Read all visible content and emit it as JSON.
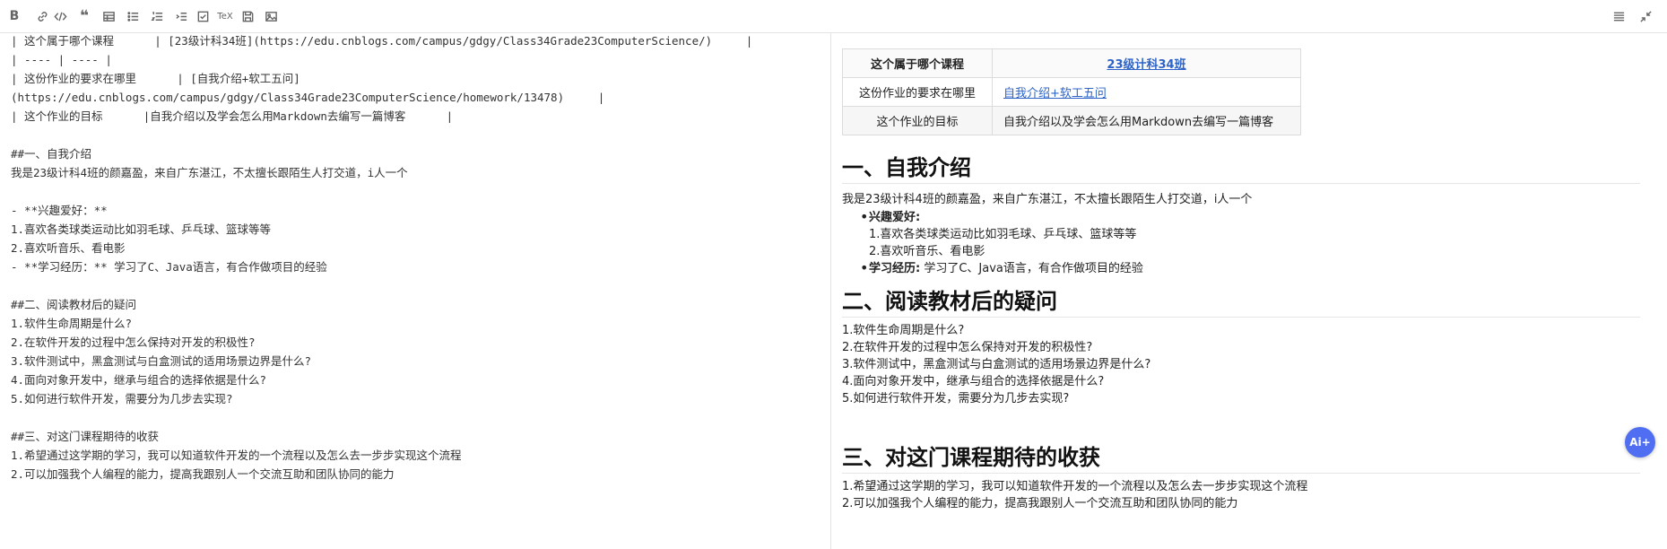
{
  "toolbar": {
    "bold": "B",
    "tex": "TeX"
  },
  "editor_lines": [
    "| 这个属于哪个课程      | [23级计科34班](https://edu.cnblogs.com/campus/gdgy/Class34Grade23ComputerScience/)     |",
    "| ---- | ---- |",
    "| 这份作业的要求在哪里      | [自我介绍+软工五问]",
    "(https://edu.cnblogs.com/campus/gdgy/Class34Grade23ComputerScience/homework/13478)     |",
    "| 这个作业的目标      |自我介绍以及学会怎么用Markdown去编写一篇博客      |",
    "",
    "##一、自我介绍",
    "我是23级计科4班的颜嘉盈，来自广东湛江，不太擅长跟陌生人打交道，i人一个",
    "",
    "- **兴趣爱好：**",
    "1.喜欢各类球类运动比如羽毛球、乒乓球、篮球等等",
    "2.喜欢听音乐、看电影",
    "- **学习经历：** 学习了C、Java语言，有合作做项目的经验",
    "",
    "##二、阅读教材后的疑问",
    "1.软件生命周期是什么?",
    "2.在软件开发的过程中怎么保持对开发的积极性?",
    "3.软件测试中，黑盒测试与白盒测试的适用场景边界是什么?",
    "4.面向对象开发中，继承与组合的选择依据是什么?",
    "5.如何进行软件开发，需要分为几步去实现?",
    "",
    "##三、对这门课程期待的收获",
    "1.希望通过这学期的学习，我可以知道软件开发的一个流程以及怎么去一步步实现这个流程",
    "2.可以加强我个人编程的能力，提高我跟别人一个交流互助和团队协同的能力"
  ],
  "preview": {
    "table": [
      {
        "k": "这个属于哪个课程",
        "v": "23级计科34班"
      },
      {
        "k": "这份作业的要求在哪里",
        "v": "自我介绍+软工五问"
      },
      {
        "k": "这个作业的目标",
        "v": "自我介绍以及学会怎么用Markdown去编写一篇博客"
      }
    ],
    "h1": "一、自我介绍",
    "intro": "我是23级计科4班的颜嘉盈，来自广东湛江，不太擅长跟陌生人打交道，i人一个",
    "hobby_label": "兴趣爱好:",
    "hobby_1": "1.喜欢各类球类运动比如羽毛球、乒乓球、篮球等等",
    "hobby_2": "2.喜欢听音乐、看电影",
    "study_label": "学习经历:",
    "study_text": " 学习了C、Java语言，有合作做项目的经验",
    "h2": "二、阅读教材后的疑问",
    "questions": [
      "1.软件生命周期是什么?",
      "2.在软件开发的过程中怎么保持对开发的积极性?",
      "3.软件测试中，黑盒测试与白盒测试的适用场景边界是什么?",
      "4.面向对象开发中，继承与组合的选择依据是什么?",
      "5.如何进行软件开发，需要分为几步去实现?"
    ],
    "h3": "三、对这门课程期待的收获",
    "gains": [
      "1.希望通过这学期的学习，我可以知道软件开发的一个流程以及怎么去一步步实现这个流程",
      "2.可以加强我个人编程的能力，提高我跟别人一个交流互助和团队协同的能力"
    ]
  },
  "ai_button": "Ai+"
}
